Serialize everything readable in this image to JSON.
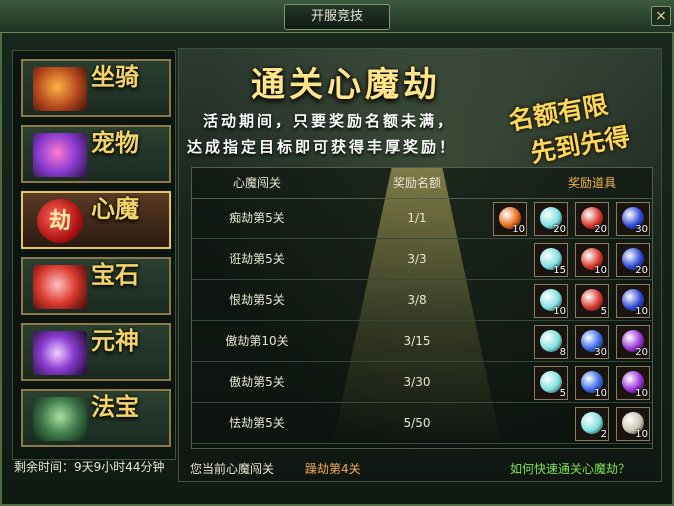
{
  "window": {
    "title": "开服竞技",
    "close_label": "×"
  },
  "sidebar": {
    "items": [
      {
        "label": "坐骑",
        "icon": "mount-icon",
        "active": false
      },
      {
        "label": "宠物",
        "icon": "pet-icon",
        "active": false
      },
      {
        "label": "心魔",
        "icon": "heart-demon-icon",
        "active": true,
        "badge": "劫"
      },
      {
        "label": "宝石",
        "icon": "gem-icon",
        "active": false
      },
      {
        "label": "元神",
        "icon": "spirit-icon",
        "active": false
      },
      {
        "label": "法宝",
        "icon": "treasure-icon",
        "active": false
      }
    ],
    "remaining_time": "剩余时间：9天9小时44分钟"
  },
  "main": {
    "headline": "通关心魔劫",
    "desc_line1": "活动期间，只要奖励名额未满，",
    "desc_line2": "达成指定目标即可获得丰厚奖励！",
    "slogan_line1": "名额有限",
    "slogan_line2": "先到先得",
    "table": {
      "headers": {
        "stage": "心魔闯关",
        "quota": "奖励名额",
        "reward": "奖励道具"
      },
      "rows": [
        {
          "stage": "痴劫第5关",
          "quota": "1/1",
          "items": [
            {
              "name": "orange-potion-icon",
              "color": "#e86a1c",
              "count": "10"
            },
            {
              "name": "cyan-orb-icon",
              "color": "#7fe0e0",
              "count": "20"
            },
            {
              "name": "red-crystal-icon",
              "color": "#d8382c",
              "count": "20"
            },
            {
              "name": "blue-pearl-icon",
              "color": "#2f49d6",
              "count": "30"
            }
          ]
        },
        {
          "stage": "诳劫第5关",
          "quota": "3/3",
          "items": [
            {
              "name": "cyan-orb-icon",
              "color": "#7fe0e0",
              "count": "15"
            },
            {
              "name": "red-crystal-icon",
              "color": "#d8382c",
              "count": "10"
            },
            {
              "name": "blue-pearl-icon",
              "color": "#2f49d6",
              "count": "20"
            }
          ]
        },
        {
          "stage": "恨劫第5关",
          "quota": "3/8",
          "items": [
            {
              "name": "cyan-orb-icon",
              "color": "#7fe0e0",
              "count": "10"
            },
            {
              "name": "red-crystal-icon",
              "color": "#d8382c",
              "count": "5"
            },
            {
              "name": "blue-pearl-icon",
              "color": "#2f49d6",
              "count": "10"
            }
          ]
        },
        {
          "stage": "傲劫第10关",
          "quota": "3/15",
          "items": [
            {
              "name": "cyan-orb-icon",
              "color": "#7fe0e0",
              "count": "8"
            },
            {
              "name": "blue-spirit-icon",
              "color": "#3a6ae8",
              "count": "30"
            },
            {
              "name": "purple-orb-icon",
              "color": "#9a34d8",
              "count": "20"
            }
          ]
        },
        {
          "stage": "傲劫第5关",
          "quota": "3/30",
          "items": [
            {
              "name": "cyan-orb-icon",
              "color": "#7fe0e0",
              "count": "5"
            },
            {
              "name": "blue-spirit-icon",
              "color": "#3a6ae8",
              "count": "10"
            },
            {
              "name": "purple-orb-icon",
              "color": "#9a34d8",
              "count": "10"
            }
          ]
        },
        {
          "stage": "怯劫第5关",
          "quota": "5/50",
          "items": [
            {
              "name": "cyan-orb-icon",
              "color": "#7fe0e0",
              "count": "2"
            },
            {
              "name": "scroll-icon",
              "color": "#c9c6b0",
              "count": "10"
            }
          ]
        }
      ]
    }
  },
  "footer": {
    "current_label": "您当前心魔闯关",
    "current_stage": "躁劫第4关",
    "help_link": "如何快速通关心魔劫？"
  }
}
